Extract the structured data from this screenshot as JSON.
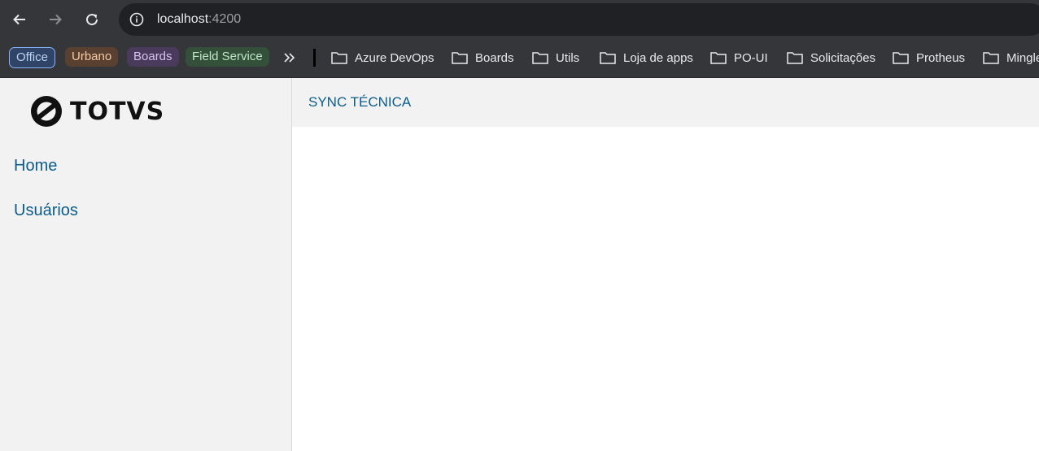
{
  "browser": {
    "url_host": "localhost",
    "url_port": ":4200",
    "bookmark_groups": [
      {
        "label": "Office",
        "color": "#b8d3f5",
        "bg": "#2f4466"
      },
      {
        "label": "Urbano",
        "color": "#f5c9a8",
        "bg": "#5a4030"
      },
      {
        "label": "Boards",
        "color": "#d9c2f0",
        "bg": "#4a3a5c"
      },
      {
        "label": "Field Service",
        "color": "#bfe6c5",
        "bg": "#34503a"
      }
    ],
    "bookmark_folders": [
      "Azure DevOps",
      "Boards",
      "Utils",
      "Loja de apps",
      "PO-UI",
      "Solicitações",
      "Protheus",
      "Mingle"
    ]
  },
  "app": {
    "logo_text": "TOTVS",
    "menu": [
      "Home",
      "Usuários"
    ],
    "page_title": "SYNC TÉCNICA"
  },
  "colors": {
    "accent": "#0c5c8c",
    "sidebar_bg": "#f2f2f2",
    "chrome_bg": "#35363a"
  }
}
